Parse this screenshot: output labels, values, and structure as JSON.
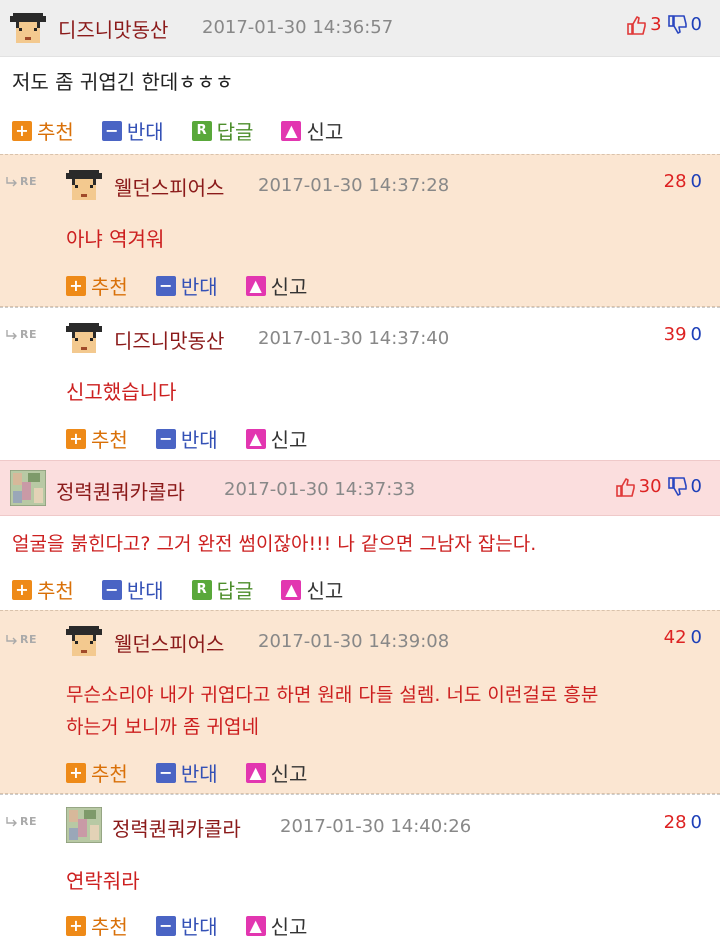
{
  "comments": [
    {
      "nick": "디즈니맛동산",
      "date": "2017-01-30 14:36:57",
      "up": "3",
      "down": "0",
      "body": "저도 좀 귀엽긴 한데ㅎㅎㅎ",
      "recommend": "추천",
      "oppose": "반대",
      "reply": "답글",
      "report": "신고"
    },
    {
      "re": "RE",
      "nick": "웰던스피어스",
      "date": "2017-01-30 14:37:28",
      "up": "28",
      "down": "0",
      "body": "아냐 역겨워",
      "recommend": "추천",
      "oppose": "반대",
      "report": "신고"
    },
    {
      "re": "RE",
      "nick": "디즈니맛동산",
      "date": "2017-01-30 14:37:40",
      "up": "39",
      "down": "0",
      "body": "신고했습니다",
      "recommend": "추천",
      "oppose": "반대",
      "report": "신고"
    },
    {
      "nick": "정력퀀쿼카콜라",
      "date": "2017-01-30 14:37:33",
      "up": "30",
      "down": "0",
      "body": "얼굴을 붉힌다고? 그거 완전 썸이잖아!!! 나 같으면 그남자 잡는다.",
      "recommend": "추천",
      "oppose": "반대",
      "reply": "답글",
      "report": "신고"
    },
    {
      "re": "RE",
      "nick": "웰던스피어스",
      "date": "2017-01-30 14:39:08",
      "up": "42",
      "down": "0",
      "body_line1": "무슨소리야 내가 귀엽다고 하면 원래 다들 설렘. 너도 이런걸로 흥분",
      "body_line2": "하는거 보니까 좀 귀엽네",
      "recommend": "추천",
      "oppose": "반대",
      "report": "신고"
    },
    {
      "re": "RE",
      "nick": "정력퀀쿼카콜라",
      "date": "2017-01-30 14:40:26",
      "up": "28",
      "down": "0",
      "body": "연락줘라",
      "recommend": "추천",
      "oppose": "반대",
      "report": "신고"
    }
  ],
  "colors": {
    "nick": "#8b1a1a",
    "up": "#dd2222",
    "down": "#1d3fb8",
    "peach_bg": "#fbe6d2",
    "pink_bg": "#fbdede"
  },
  "icons": {
    "thumb_up": "thumbs-up-icon",
    "thumb_down": "thumbs-down-icon",
    "plus": "plus-icon",
    "minus": "minus-icon",
    "reply": "reply-r-icon",
    "report": "alarm-icon",
    "avatar_a": "pixel-avatar-face",
    "avatar_b": "photo-avatar"
  }
}
